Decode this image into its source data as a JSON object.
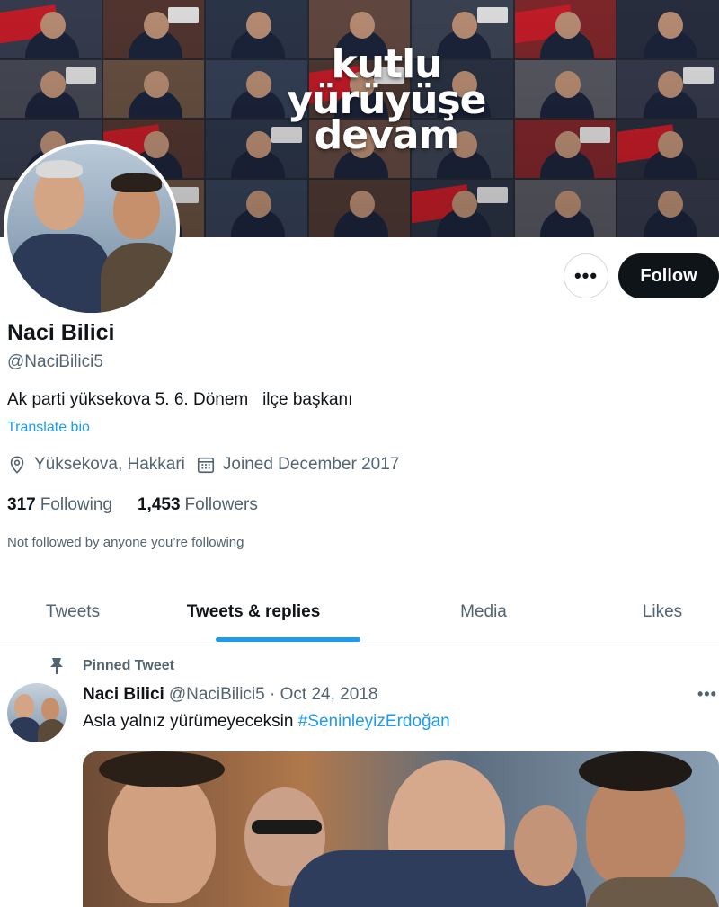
{
  "banner": {
    "slogan_line1": "kutlu",
    "slogan_line2": "yürüyüşe",
    "slogan_line3": "devam"
  },
  "profile": {
    "name": "Naci Bilici",
    "handle": "@NaciBilici5",
    "bio": "Ak parti yüksekova 5. 6. Dönem   ilçe başkanı",
    "translate_label": "Translate bio",
    "location": "Yüksekova, Hakkari",
    "joined": "Joined December 2017",
    "following_count": "317",
    "following_label": "Following",
    "followers_count": "1,453",
    "followers_label": "Followers",
    "not_followed": "Not followed by anyone you’re following",
    "more_label": "•••",
    "follow_label": "Follow"
  },
  "tabs": [
    {
      "label": "Tweets"
    },
    {
      "label": "Tweets & replies"
    },
    {
      "label": "Media"
    },
    {
      "label": "Likes"
    }
  ],
  "pinned_tweet": {
    "pinned_label": "Pinned Tweet",
    "author": "Naci Bilici",
    "handle_date": "@NaciBilici5 · Oct 24, 2018",
    "more_label": "•••",
    "text": "Asla yalnız yürümeyeceksin ",
    "hashtag": "#SeninleyizErdoğan"
  },
  "colors": {
    "accent": "#1d9bf0",
    "text": "#0f1419",
    "secondary": "#536471",
    "follow_bg": "#0f1419"
  }
}
